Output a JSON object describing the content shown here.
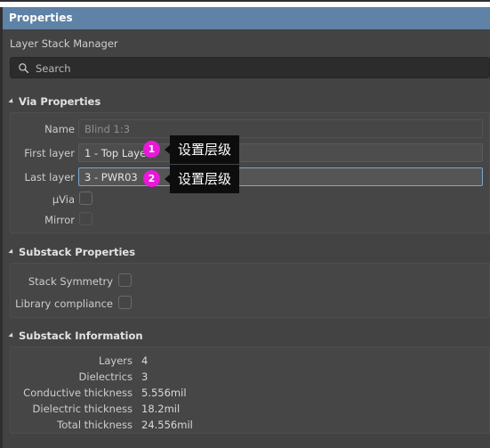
{
  "window": {
    "title": "Properties",
    "subtitle": "Layer Stack Manager",
    "accent_color": "#5f82a7",
    "badge_color": "#e819d8"
  },
  "search": {
    "placeholder": "Search",
    "icon": "search-icon",
    "value": ""
  },
  "sections": {
    "via_properties": {
      "title": "Via Properties",
      "collapse_icon": "chevron-down-icon",
      "fields": {
        "name": {
          "label": "Name",
          "value": "Blind 1:3",
          "state": "ghost"
        },
        "first_layer": {
          "label": "First layer",
          "value": "1 - Top Layer",
          "state": "normal"
        },
        "last_layer": {
          "label": "Last layer",
          "value": "3 - PWR03",
          "state": "focused"
        },
        "uvia": {
          "label": "µVia",
          "checked": false,
          "state": "enabled"
        },
        "mirror": {
          "label": "Mirror",
          "checked": false,
          "state": "disabled"
        }
      }
    },
    "substack_properties": {
      "title": "Substack Properties",
      "collapse_icon": "chevron-down-icon",
      "fields": {
        "stack_symmetry": {
          "label": "Stack Symmetry",
          "checked": false
        },
        "library_compliance": {
          "label": "Library compliance",
          "checked": false
        }
      }
    },
    "substack_information": {
      "title": "Substack Information",
      "collapse_icon": "chevron-down-icon",
      "rows": [
        {
          "label": "Layers",
          "value": "4"
        },
        {
          "label": "Dielectrics",
          "value": "3"
        },
        {
          "label": "Conductive thickness",
          "value": "5.556mil"
        },
        {
          "label": "Dielectric thickness",
          "value": "18.2mil"
        },
        {
          "label": "Total thickness",
          "value": "24.556mil"
        }
      ]
    }
  },
  "annotations": [
    {
      "number": "1",
      "tooltip": "设置层级"
    },
    {
      "number": "2",
      "tooltip": "设置层级"
    }
  ]
}
